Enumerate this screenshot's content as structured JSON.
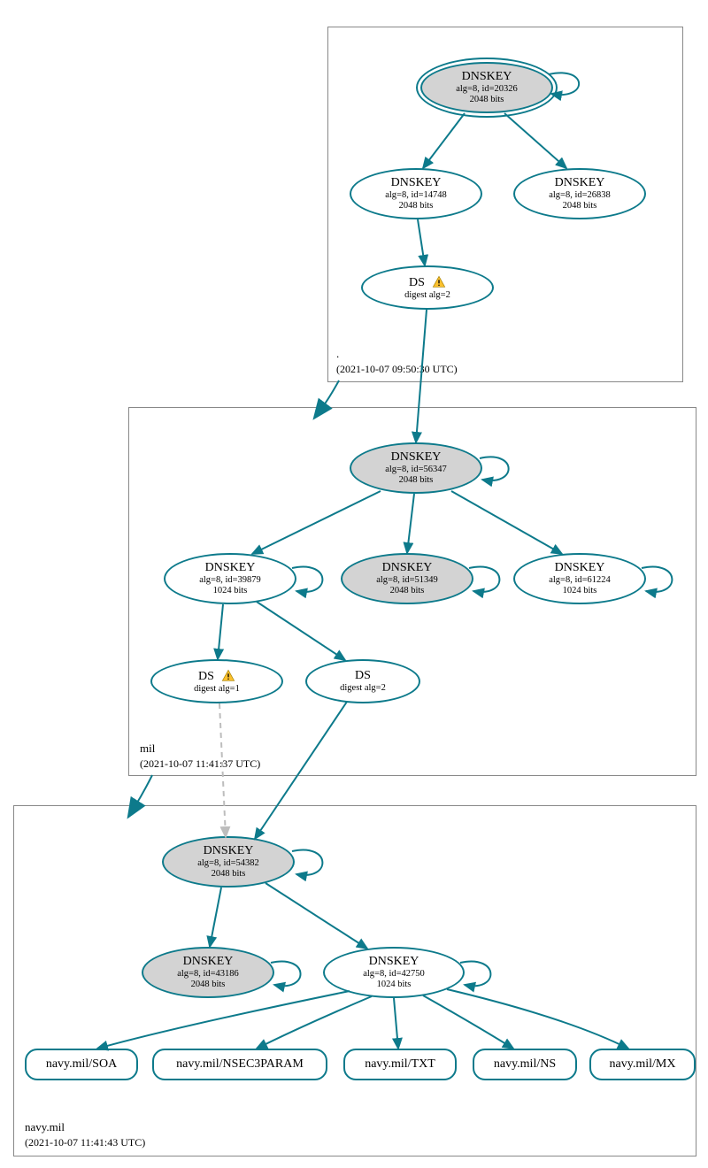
{
  "zones": {
    "root": {
      "name": ".",
      "ts": "(2021-10-07 09:50:30 UTC)"
    },
    "mil": {
      "name": "mil",
      "ts": "(2021-10-07 11:41:37 UTC)"
    },
    "navy": {
      "name": "navy.mil",
      "ts": "(2021-10-07 11:41:43 UTC)"
    }
  },
  "nodes": {
    "root_ksk": {
      "title": "DNSKEY",
      "l1": "alg=8, id=20326",
      "l2": "2048 bits"
    },
    "root_zsk1": {
      "title": "DNSKEY",
      "l1": "alg=8, id=14748",
      "l2": "2048 bits"
    },
    "root_zsk2": {
      "title": "DNSKEY",
      "l1": "alg=8, id=26838",
      "l2": "2048 bits"
    },
    "root_ds": {
      "title": "DS",
      "l1": "digest alg=2"
    },
    "mil_ksk": {
      "title": "DNSKEY",
      "l1": "alg=8, id=56347",
      "l2": "2048 bits"
    },
    "mil_k1": {
      "title": "DNSKEY",
      "l1": "alg=8, id=39879",
      "l2": "1024 bits"
    },
    "mil_k2": {
      "title": "DNSKEY",
      "l1": "alg=8, id=51349",
      "l2": "2048 bits"
    },
    "mil_k3": {
      "title": "DNSKEY",
      "l1": "alg=8, id=61224",
      "l2": "1024 bits"
    },
    "mil_ds1": {
      "title": "DS",
      "l1": "digest alg=1"
    },
    "mil_ds2": {
      "title": "DS",
      "l1": "digest alg=2"
    },
    "navy_ksk": {
      "title": "DNSKEY",
      "l1": "alg=8, id=54382",
      "l2": "2048 bits"
    },
    "navy_k1": {
      "title": "DNSKEY",
      "l1": "alg=8, id=43186",
      "l2": "2048 bits"
    },
    "navy_k2": {
      "title": "DNSKEY",
      "l1": "alg=8, id=42750",
      "l2": "1024 bits"
    },
    "rr_soa": "navy.mil/SOA",
    "rr_nsec3": "navy.mil/NSEC3PARAM",
    "rr_txt": "navy.mil/TXT",
    "rr_ns": "navy.mil/NS",
    "rr_mx": "navy.mil/MX"
  }
}
